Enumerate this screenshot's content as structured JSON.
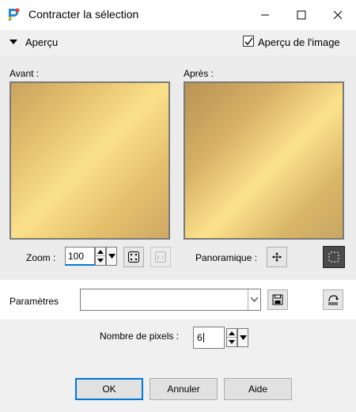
{
  "window": {
    "title": "Contracter la sélection",
    "icons": {
      "app": "app-logo-icon",
      "minimize": "minimize-icon",
      "maximize": "maximize-icon",
      "close": "close-icon"
    }
  },
  "preview_section": {
    "label": "Aperçu",
    "image_preview_checkbox": {
      "label": "Aperçu de l'image",
      "checked": true
    }
  },
  "preview_panes": {
    "before_label": "Avant :",
    "after_label": "Après :"
  },
  "zoom": {
    "label": "Zoom :",
    "value": "100",
    "icons": {
      "spinner": "spinner-icon",
      "dropdown": "dropdown-arrow-icon",
      "zoom_fit": "zoom-fit-icon",
      "zoom_actual": "zoom-1to1-icon"
    }
  },
  "panoramique": {
    "label": "Panoramique :",
    "icons": {
      "pan": "pan-move-icon",
      "select": "selection-marquee-icon"
    }
  },
  "parametres": {
    "label": "Paramètres",
    "value": "",
    "icons": {
      "combo_arrow": "chevron-down-icon",
      "save": "save-preset-icon",
      "reset": "reset-icon"
    }
  },
  "pixels": {
    "label": "Nombre de pixels :",
    "value": "6"
  },
  "buttons": {
    "ok": "OK",
    "cancel": "Annuler",
    "help": "Aide"
  },
  "colors": {
    "accent": "#0078d7",
    "gold_light": "#fde28c",
    "gold_dark": "#c9a35e"
  }
}
